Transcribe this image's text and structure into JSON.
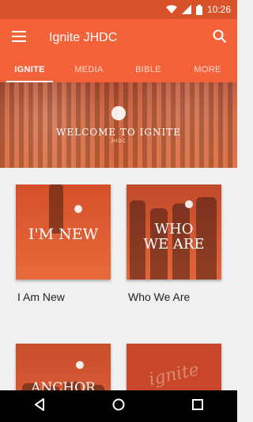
{
  "status": {
    "time": "10:26"
  },
  "app": {
    "title": "Ignite JHDC"
  },
  "tabs": [
    {
      "label": "IGNITE",
      "active": true
    },
    {
      "label": "MEDIA",
      "active": false
    },
    {
      "label": "BIBLE",
      "active": false
    },
    {
      "label": "MORE",
      "active": false
    }
  ],
  "hero": {
    "title": "WELCOME TO IGNITE",
    "subtitle": "JHDC"
  },
  "cards": [
    {
      "overlay": "I'M NEW",
      "label": "I Am New"
    },
    {
      "overlay": "WHO\nWE ARE",
      "label": "Who We Are"
    },
    {
      "overlay": "ANCHOR",
      "label": ""
    },
    {
      "overlay": "ignite",
      "label": ""
    }
  ],
  "colors": {
    "primary": "#f4623a",
    "status": "#d9532a",
    "accent_card": "#e4602f"
  }
}
